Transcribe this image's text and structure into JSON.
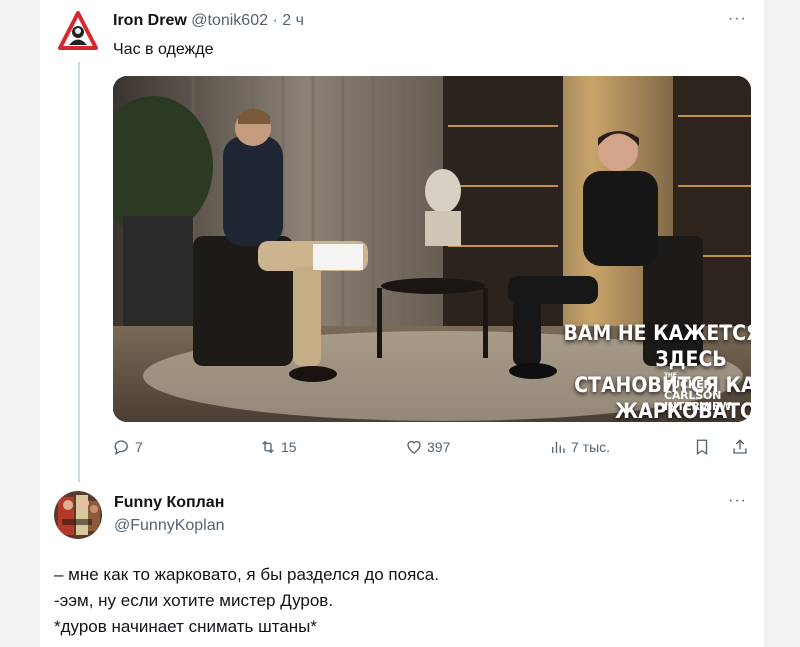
{
  "tweet1": {
    "display_name": "Iron Drew",
    "handle": "@tonik602",
    "separator": "·",
    "time": "2 ч",
    "text": "Час в одежде",
    "more": "···",
    "media": {
      "caption_lines": [
        "ВАМ НЕ КАЖЕТСЯ, ЧТО ЗДЕСЬ",
        "СТАНОВИТСЯ КАК-ТО",
        "ЖАРКОВАТО?"
      ],
      "watermark": [
        "THE",
        "TUCKER",
        "CARLSON",
        "INTERVIEW"
      ]
    },
    "actions": {
      "replies": "7",
      "reposts": "15",
      "likes": "397",
      "views": "7 тыс."
    }
  },
  "tweet2": {
    "display_name": "Funny Коплан",
    "handle": "@FunnyKoplan",
    "more": "···",
    "lines": [
      "– мне как то жарковато, я бы разделся до пояса.",
      "-ээм, ну если хотите мистер Дуров.",
      "*дуров начинает снимать штаны*"
    ]
  },
  "icons": {
    "reply": "reply-icon",
    "repost": "repost-icon",
    "like": "like-icon",
    "views": "views-icon",
    "bookmark": "bookmark-icon",
    "share": "share-icon"
  },
  "colors": {
    "text": "#0f1419",
    "secondary": "#536471",
    "thread_line": "#cfd9de",
    "avatar_red": "#d8262f"
  }
}
